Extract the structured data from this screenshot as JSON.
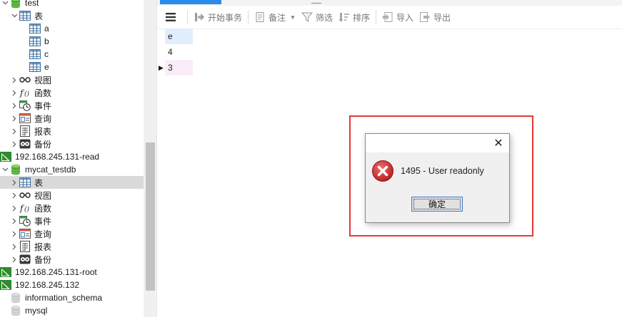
{
  "nav": {
    "items": [
      {
        "level": 1,
        "expand": "open",
        "icon": "database-green-icon",
        "label": "test",
        "selected": false
      },
      {
        "level": 2,
        "expand": "open",
        "icon": "table-folder-icon",
        "label": "表",
        "selected": false
      },
      {
        "level": 3,
        "expand": "none",
        "icon": "table-icon",
        "label": "a",
        "selected": false
      },
      {
        "level": 3,
        "expand": "none",
        "icon": "table-icon",
        "label": "b",
        "selected": false
      },
      {
        "level": 3,
        "expand": "none",
        "icon": "table-icon",
        "label": "c",
        "selected": false
      },
      {
        "level": 3,
        "expand": "none",
        "icon": "table-icon",
        "label": "e",
        "selected": false
      },
      {
        "level": 2,
        "expand": "closed",
        "icon": "view-icon",
        "label": "视图",
        "selected": false
      },
      {
        "level": 2,
        "expand": "closed",
        "icon": "function-icon",
        "label": "函数",
        "selected": false
      },
      {
        "level": 2,
        "expand": "closed",
        "icon": "event-icon",
        "label": "事件",
        "selected": false
      },
      {
        "level": 2,
        "expand": "closed",
        "icon": "query-icon",
        "label": "查询",
        "selected": false
      },
      {
        "level": 2,
        "expand": "closed",
        "icon": "report-icon",
        "label": "报表",
        "selected": false
      },
      {
        "level": 2,
        "expand": "closed",
        "icon": "backup-icon",
        "label": "备份",
        "selected": false
      },
      {
        "level": 0,
        "expand": "none",
        "icon": "connection-icon",
        "label": "192.168.245.131-read",
        "selected": false
      },
      {
        "level": 1,
        "expand": "open",
        "icon": "database-green-icon",
        "label": "mycat_testdb",
        "selected": false
      },
      {
        "level": 2,
        "expand": "closed",
        "icon": "table-folder-icon",
        "label": "表",
        "selected": true
      },
      {
        "level": 2,
        "expand": "closed",
        "icon": "view-icon",
        "label": "视图",
        "selected": false
      },
      {
        "level": 2,
        "expand": "closed",
        "icon": "function-icon",
        "label": "函数",
        "selected": false
      },
      {
        "level": 2,
        "expand": "closed",
        "icon": "event-icon",
        "label": "事件",
        "selected": false
      },
      {
        "level": 2,
        "expand": "closed",
        "icon": "query-icon",
        "label": "查询",
        "selected": false
      },
      {
        "level": 2,
        "expand": "closed",
        "icon": "report-icon",
        "label": "报表",
        "selected": false
      },
      {
        "level": 2,
        "expand": "closed",
        "icon": "backup-icon",
        "label": "备份",
        "selected": false
      },
      {
        "level": 0,
        "expand": "none",
        "icon": "connection-icon",
        "label": "192.168.245.131-root",
        "selected": false
      },
      {
        "level": 0,
        "expand": "none",
        "icon": "connection-icon",
        "label": "192.168.245.132",
        "selected": false
      },
      {
        "level": 1,
        "expand": "none",
        "icon": "database-gray-icon",
        "label": "information_schema",
        "selected": false
      },
      {
        "level": 1,
        "expand": "none",
        "icon": "database-gray-icon",
        "label": "mysql",
        "selected": false
      }
    ]
  },
  "toolbar": {
    "menu_icon": "hamburger-menu-icon",
    "begin_transaction": "开始事务",
    "memo": "备注",
    "filter": "筛选",
    "sort": "排序",
    "import": "导入",
    "export": "导出"
  },
  "grid": {
    "column": "e",
    "rows": [
      "4",
      "3"
    ],
    "current_row_marker": "▶"
  },
  "dialog": {
    "message": "1495 - User readonly",
    "ok_label": "确定",
    "close_glyph": "✕",
    "icon": "error-icon"
  },
  "colors": {
    "connection_green": "#3a9b2f",
    "database_green": "#5cb85c",
    "header_blue": "#e1eefb",
    "selected_row_pink": "#fbecfa",
    "highlight_red": "#e53935",
    "error_red": "#d32f2f",
    "active_tab_blue": "#2b8be8"
  }
}
